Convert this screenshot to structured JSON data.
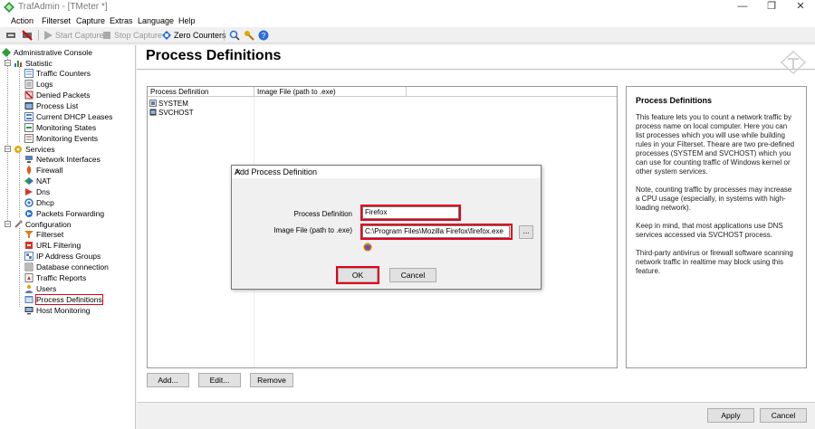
{
  "window": {
    "title": "TrafAdmin - [TMeter *]",
    "min_glyph": "—",
    "max_glyph": "❐",
    "close_glyph": "✕"
  },
  "menu": [
    "Action",
    "Filterset",
    "Capture",
    "Extras",
    "Language",
    "Help"
  ],
  "toolbar": {
    "start_capture": "Start Capture",
    "stop_capture": "Stop Capture",
    "zero_counters": "Zero Counters"
  },
  "tree": {
    "root": "Administrative Console",
    "statistic": "Statistic",
    "statistic_items": [
      "Traffic Counters",
      "Logs",
      "Denied Packets",
      "Process List",
      "Current DHCP Leases",
      "Monitoring States",
      "Monitoring Events"
    ],
    "services": "Services",
    "services_items": [
      "Network Interfaces",
      "Firewall",
      "NAT",
      "Dns",
      "Dhcp",
      "Packets Forwarding"
    ],
    "configuration": "Configuration",
    "configuration_items": [
      "Filterset",
      "URL Filtering",
      "IP Address Groups",
      "Database connection",
      "Traffic Reports",
      "Users",
      "Process Definitions"
    ],
    "host_monitoring": "Host Monitoring",
    "selected": "Process Definitions"
  },
  "main": {
    "page_title": "Process Definitions",
    "columns": [
      "Process Definition",
      "Image File (path to .exe)"
    ],
    "rows": [
      {
        "name": "SYSTEM",
        "path": ""
      },
      {
        "name": "SVCHOST",
        "path": ""
      }
    ],
    "add_button": "Add...",
    "edit_button": "Edit...",
    "remove_button": "Remove",
    "apply_button": "Apply",
    "cancel_button": "Cancel"
  },
  "info": {
    "title": "Process Definitions",
    "p1": "This feature lets you to count a network traffic by process name on local computer. Here you can list processes which you will use while building rules in your Filterset. Theare are two pre-defined processes (SYSTEM and SVCHOST) which you can use for counting traffic of Windows kernel or other system services.",
    "p2": "Note, counting traffic by processes may increase a CPU usage (especially, in systems with high-loading network).",
    "p3": "Keep in mind, that most applications use DNS services accessed via SVCHOST process.",
    "p4": "Third-party antivirus or firewall software scanning network traffic in realtime may block using this feature."
  },
  "dialog": {
    "title": "Add Process Definition",
    "close_glyph": "✕",
    "label_definition": "Process Definition",
    "label_image": "Image File (path to .exe)",
    "definition_value": "Firefox",
    "image_value": "C:\\Program Files\\Mozilla Firefox\\firefox.exe",
    "browse_label": "...",
    "ok_label": "OK",
    "cancel_label": "Cancel"
  },
  "colors": {
    "highlight_red": "#e2001a",
    "tree_green": "#2e9e3a"
  }
}
